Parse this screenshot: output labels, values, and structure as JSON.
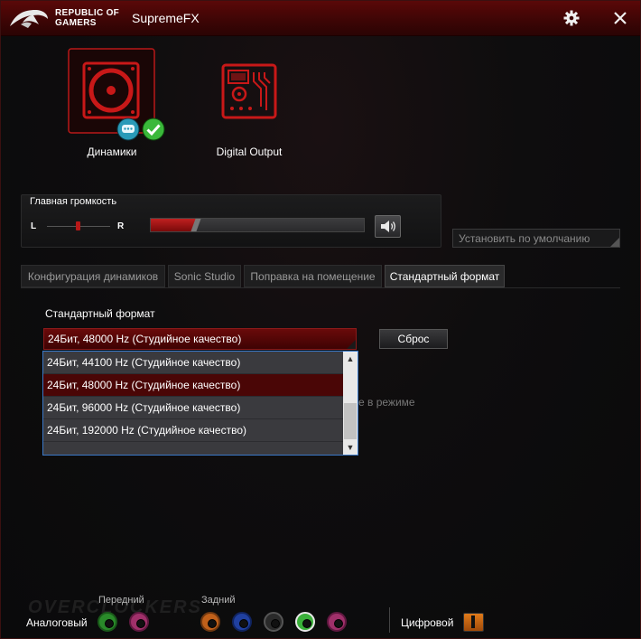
{
  "titlebar": {
    "brand_line1": "REPUBLIC OF",
    "brand_line2": "GAMERS",
    "app_title": "SupremeFX",
    "icons": [
      "gear-icon",
      "close-icon"
    ]
  },
  "devices": [
    {
      "label": "Динамики",
      "selected": true,
      "icon": "speaker-icon",
      "badges": [
        "chat-bubble-icon",
        "checkmark-icon"
      ]
    },
    {
      "label": "Digital Output",
      "selected": false,
      "icon": "circuit-board-icon"
    }
  ],
  "volume": {
    "title": "Главная громкость",
    "left_label": "L",
    "right_label": "R",
    "level_fraction": 0.21,
    "balance_fraction": 0.5
  },
  "default_button": "Установить по умолчанию",
  "tabs": [
    {
      "label": "Конфигурация динамиков",
      "active": false
    },
    {
      "label": "Sonic Studio",
      "active": false
    },
    {
      "label": "Поправка на помещение",
      "active": false
    },
    {
      "label": "Стандартный формат",
      "active": true
    }
  ],
  "format": {
    "label": "Стандартный формат",
    "selected_value": "24Бит, 48000 Hz (Студийное качество)",
    "reset_label": "Сброс",
    "behind_text": "е в режиме",
    "options": [
      {
        "label": "24Бит, 44100 Hz (Студийное качество)",
        "selected": false
      },
      {
        "label": "24Бит, 48000 Hz (Студийное качество)",
        "selected": true
      },
      {
        "label": "24Бит, 96000 Hz (Студийное качество)",
        "selected": false
      },
      {
        "label": "24Бит, 192000 Hz (Студийное качество)",
        "selected": false
      }
    ]
  },
  "ports": {
    "front_label": "Передний",
    "rear_label": "Задний",
    "analog_label": "Аналоговый",
    "digital_label": "Цифровой",
    "watermark": "OVERCLOCKERS",
    "colors": {
      "front_green": "#2a8a2a",
      "front_pink": "#a0306a",
      "rear_orange": "#c0601a",
      "rear_blue": "#2040a0",
      "rear_black": "#2a2a2a",
      "rear_green": "#3ab03a",
      "rear_pink": "#a0306a",
      "accent": "#b81818"
    }
  }
}
